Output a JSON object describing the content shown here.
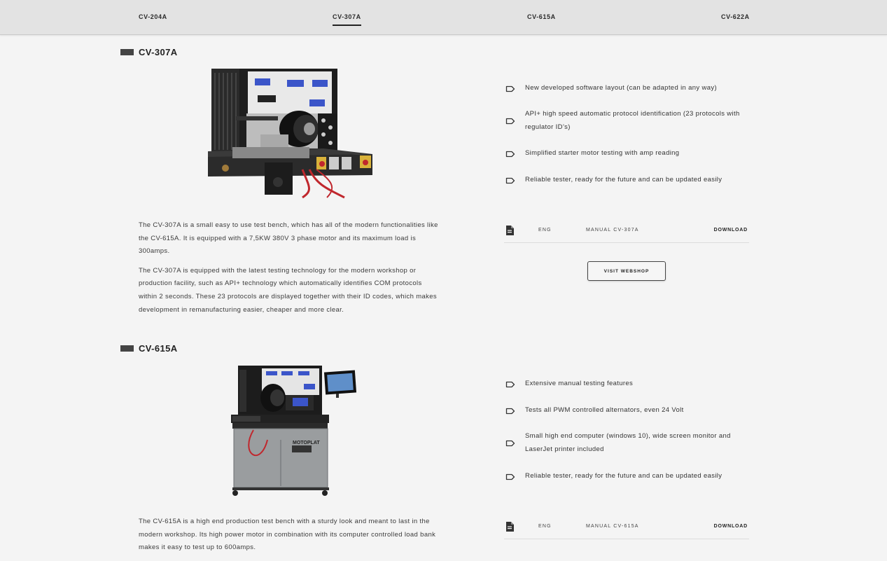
{
  "nav": {
    "tabs": [
      {
        "label": "CV-204A"
      },
      {
        "label": "CV-307A",
        "active": true
      },
      {
        "label": "CV-615A"
      },
      {
        "label": "CV-622A"
      }
    ]
  },
  "products": [
    {
      "title": "CV-307A",
      "description": [
        "The CV-307A is a small easy to use test bench, which has all of the modern functionalities like the CV-615A. It is equipped with a 7,5KW 380V 3 phase motor and its maximum load is 300amps.",
        "The CV-307A is equipped with the latest testing technology for the modern workshop or production facility, such as API+ technology which automatically identifies COM protocols within 2 seconds. These 23 protocols are displayed together with their ID codes, which makes development in remanufacturing easier, cheaper and more clear."
      ],
      "features": [
        "New developed software layout (can be adapted in any way)",
        "API+ high speed automatic protocol identification (23 protocols with regulator ID’s)",
        "Simplified starter motor testing with amp reading",
        "Reliable tester, ready for the future and can be updated easily"
      ],
      "manual": {
        "lang": "ENG",
        "name": "MANUAL CV-307A",
        "download": "DOWNLOAD"
      },
      "webshop_label": "VISIT WEBSHOP"
    },
    {
      "title": "CV-615A",
      "description": [
        "The CV-615A is a high end production test bench with a sturdy look and meant to last in the modern workshop. Its high power motor in combination with its computer controlled load bank makes it easy to test up to 600amps."
      ],
      "features": [
        "Extensive manual testing features",
        "Tests all PWM controlled alternators, even 24 Volt",
        "Small high end computer (windows 10), wide screen monitor and LaserJet printer included",
        "Reliable tester, ready for the future and can be updated easily"
      ],
      "manual": {
        "lang": "ENG",
        "name": "MANUAL CV-615A",
        "download": "DOWNLOAD"
      }
    }
  ],
  "colors": {
    "background": "#f4f4f4",
    "topbar": "#e3e3e3",
    "text": "#2a2a2a",
    "accent": "#444444"
  },
  "icons": {
    "feature": "tag-outline-icon",
    "manual": "document-icon"
  }
}
